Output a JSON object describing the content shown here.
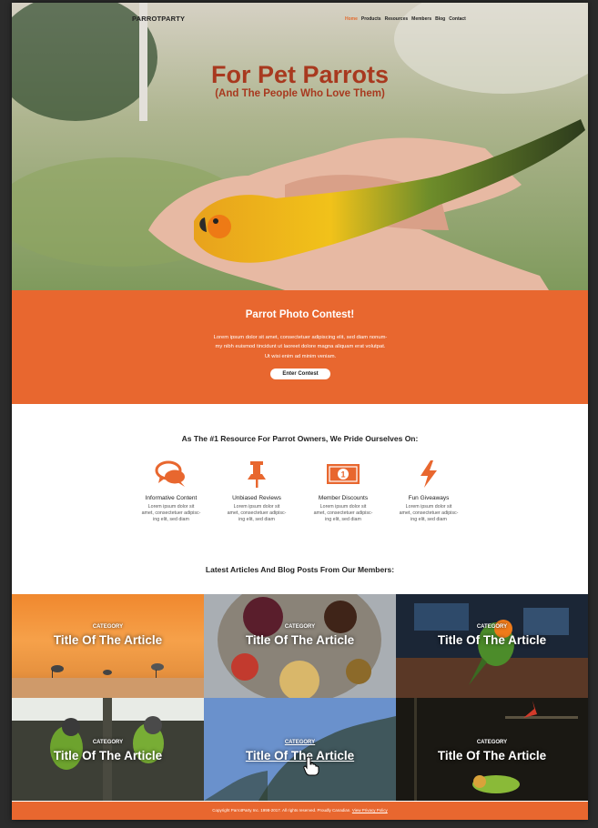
{
  "brand": "PARROTPARTY",
  "nav": [
    "Home",
    "Products",
    "Resources",
    "Members",
    "Blog",
    "Contact"
  ],
  "hero": {
    "title": "For Pet Parrots",
    "subtitle": "(And The People Who Love Them)"
  },
  "contest": {
    "title": "Parrot Photo Contest!",
    "body_lines": [
      "Lorem ipsum dolor sit amet, consectetuer adipiscing elit, sed diam nonum-",
      "my nibh euismod tincidunt ut laoreet dolore magna aliquam erat volutpat.",
      "Ut wisi enim ad minim veniam."
    ],
    "button": "Enter Contest"
  },
  "features": {
    "heading": "As The #1 Resource For Parrot Owners, We Pride Ourselves On:",
    "items": [
      {
        "icon": "chat-bubbles-icon",
        "title": "Informative Content",
        "desc": [
          "Lorem ipsum dolor sit",
          "amet, consectetuer adipisc-",
          "ing elit, sed diam"
        ]
      },
      {
        "icon": "pushpin-icon",
        "title": "Unbiased Reviews",
        "desc": [
          "Lorem ipsum dolor sit",
          "amet, consectetuer adipisc-",
          "ing elit, sed diam"
        ]
      },
      {
        "icon": "money-icon",
        "title": "Member Discounts",
        "desc": [
          "Lorem ipsum dolor sit",
          "amet, consectetuer adipisc-",
          "ing elit, sed diam"
        ]
      },
      {
        "icon": "lightning-icon",
        "title": "Fun Giveaways",
        "desc": [
          "Lorem ipsum dolor sit",
          "amet, consectetuer adipisc-",
          "ing elit, sed diam"
        ]
      }
    ]
  },
  "articles": {
    "heading": "Latest Articles And Blog Posts From Our Members:",
    "items": [
      {
        "category": "CATEGORY",
        "title": "Title Of The Article"
      },
      {
        "category": "CATEGORY",
        "title": "Title Of The Article"
      },
      {
        "category": "CATEGORY",
        "title": "Title Of The Article"
      },
      {
        "category": "CATEGORY",
        "title": "Title Of The Article"
      },
      {
        "category": "CATEGORY",
        "title": "Title Of The Article"
      },
      {
        "category": "CATEGORY",
        "title": "Title Of The Article"
      }
    ]
  },
  "footer": {
    "copyright": "Copyright ParrotParty Inc. 1998-2017. All rights reserved. Proudly Canadian.",
    "link": "View Privacy Policy"
  },
  "colors": {
    "accent": "#e8672f",
    "hero_title": "#a8391f",
    "active_nav": "#e36a2e"
  }
}
